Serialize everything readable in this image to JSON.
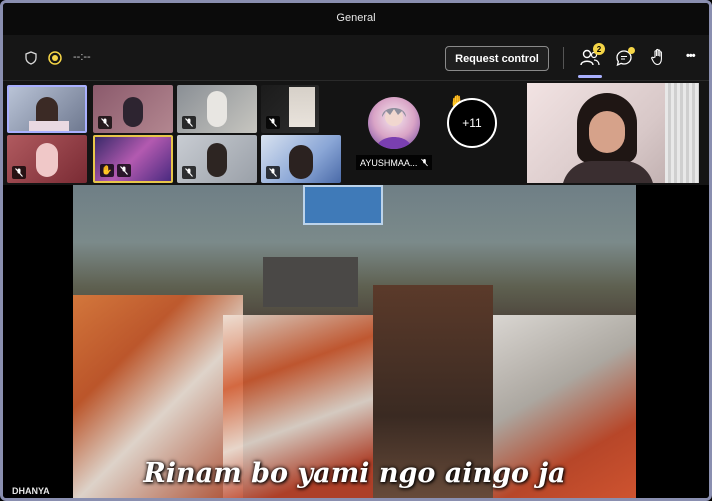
{
  "window": {
    "title": "General"
  },
  "toolbar": {
    "timer": "--:--",
    "request_control_label": "Request control",
    "participants_count": "2",
    "more_label": "•••"
  },
  "participants": [
    {
      "name": "",
      "muted": false,
      "hand": false
    },
    {
      "name": "",
      "muted": true,
      "hand": false
    },
    {
      "name": "",
      "muted": true,
      "hand": false
    },
    {
      "name": "",
      "muted": true,
      "hand": false
    },
    {
      "name": "",
      "muted": true,
      "hand": false
    },
    {
      "name": "",
      "muted": true,
      "hand": true
    },
    {
      "name": "",
      "muted": true,
      "hand": false
    },
    {
      "name": "",
      "muted": true,
      "hand": false
    }
  ],
  "avatar_participant": {
    "name": "AYUSHMAA...",
    "muted": true
  },
  "overflow": {
    "label": "+11",
    "hand_raised": true
  },
  "stage": {
    "subtitle": "Rinam bo yami ngo aingo ja",
    "presenter_name": "DHANYA"
  },
  "colors": {
    "accent": "#a9b0ff",
    "badge": "#f5d547",
    "spotlight_border": "#e8c64a"
  }
}
